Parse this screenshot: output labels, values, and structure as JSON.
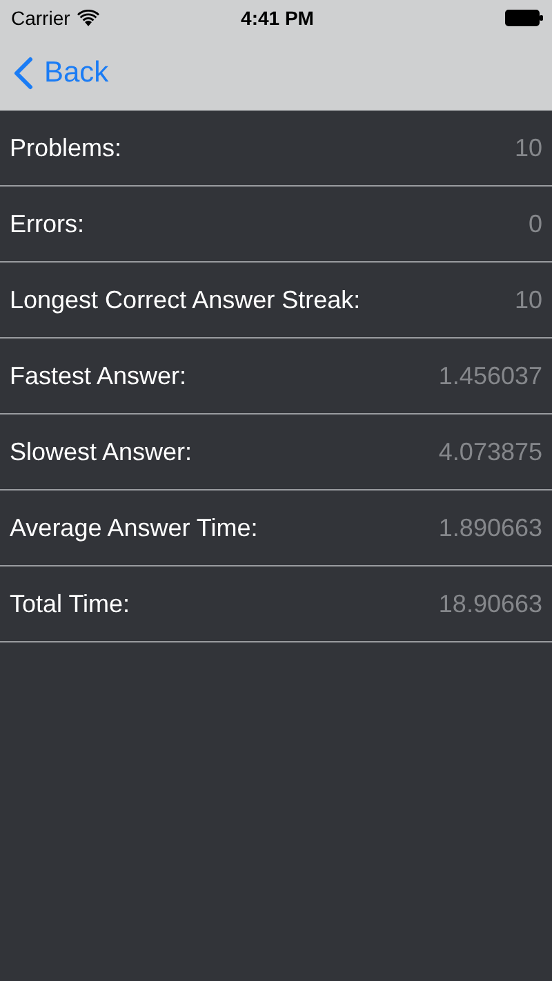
{
  "status_bar": {
    "carrier": "Carrier",
    "time": "4:41 PM"
  },
  "nav_bar": {
    "back_label": "Back"
  },
  "stats": [
    {
      "label": "Problems:",
      "value": "10"
    },
    {
      "label": "Errors:",
      "value": "0"
    },
    {
      "label": "Longest Correct Answer Streak:",
      "value": "10"
    },
    {
      "label": "Fastest Answer:",
      "value": "1.456037"
    },
    {
      "label": "Slowest Answer:",
      "value": "4.073875"
    },
    {
      "label": "Average Answer Time:",
      "value": "1.890663"
    },
    {
      "label": "Total Time:",
      "value": "18.90663"
    }
  ]
}
